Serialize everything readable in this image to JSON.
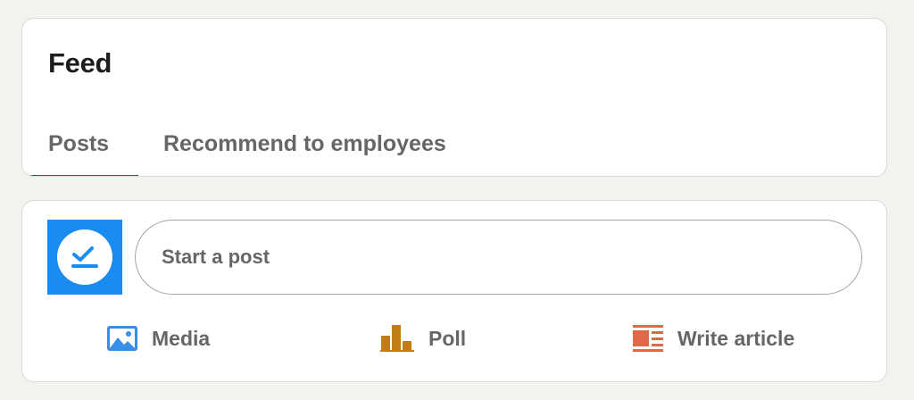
{
  "feed": {
    "title": "Feed",
    "tabs": [
      {
        "label": "Posts",
        "active": true
      },
      {
        "label": "Recommend to employees",
        "active": false
      }
    ],
    "active_tab_color": "#057642"
  },
  "composer": {
    "avatar_icon": "checkmark-tray-icon",
    "avatar_color": "#1a8cf0",
    "start_post_placeholder": "Start a post",
    "actions": [
      {
        "label": "Media",
        "icon": "image-icon",
        "color": "#378fe9"
      },
      {
        "label": "Poll",
        "icon": "poll-chart-icon",
        "color": "#c37d16"
      },
      {
        "label": "Write article",
        "icon": "article-icon",
        "color": "#e06847"
      }
    ]
  }
}
